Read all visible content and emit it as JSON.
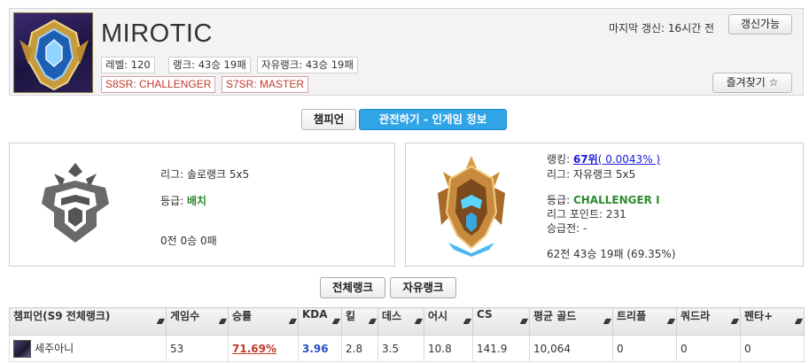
{
  "profile": {
    "summoner_name": "MIROTIC",
    "level_label": "레벨: 120",
    "solo_rank_record": "랭크: 43승 19패",
    "flex_rank_record": "자유랭크: 43승 19패",
    "past_ranks": [
      "S8SR: CHALLENGER",
      "S7SR: MASTER"
    ],
    "last_updated": "마지막 갱신: 16시간 전",
    "refresh_button": "갱신가능",
    "favorite_button": "즐겨찾기 ☆"
  },
  "tabs": [
    {
      "label": "챔피언"
    },
    {
      "label": "관전하기 - 인게임 정보"
    }
  ],
  "solo_panel": {
    "league": "리그: 솔로랭크 5x5",
    "tier_prefix": "등급:",
    "tier": "배치",
    "record": "0전 0승 0패"
  },
  "flex_panel": {
    "ranking_prefix": "랭킹:",
    "ranking": "67위",
    "ranking_percent": "( 0.0043% )",
    "league": "리그: 자유랭크 5x5",
    "tier_prefix": "등급:",
    "tier": "CHALLENGER I",
    "league_points": "리그 포인트: 231",
    "promotion": "승급전: -",
    "record": "62전 43승 19패 (69.35%)"
  },
  "queue_buttons": [
    {
      "label": "전체랭크"
    },
    {
      "label": "자유랭크"
    }
  ],
  "table": {
    "headers": [
      "챔피언(S9 전체랭크)",
      "게임수",
      "승률",
      "KDA",
      "킬",
      "데스",
      "어시",
      "CS",
      "평균 골드",
      "트리플",
      "쿼드라",
      "펜타+"
    ],
    "rows": [
      {
        "champion": "세주아니",
        "games": "53",
        "win_rate": "71.69%",
        "kda": "3.96",
        "kills": "2.8",
        "deaths": "3.5",
        "assists": "10.8",
        "cs": "141.9",
        "avg_gold": "10,064",
        "triple": "0",
        "quadra": "0",
        "penta": "0"
      }
    ]
  },
  "colors": {
    "accent_blue": "#2fa4e7",
    "win_rate_red": "#c0392b",
    "tier_green": "#2e8b2e",
    "link_blue": "#1a1adb"
  },
  "icons": {
    "profile_icon": "gold-blue-emblem-icon",
    "solo_emblem": "unranked-emblem-icon",
    "flex_emblem": "challenger-emblem-icon",
    "sort": "sort-arrows-icon"
  }
}
